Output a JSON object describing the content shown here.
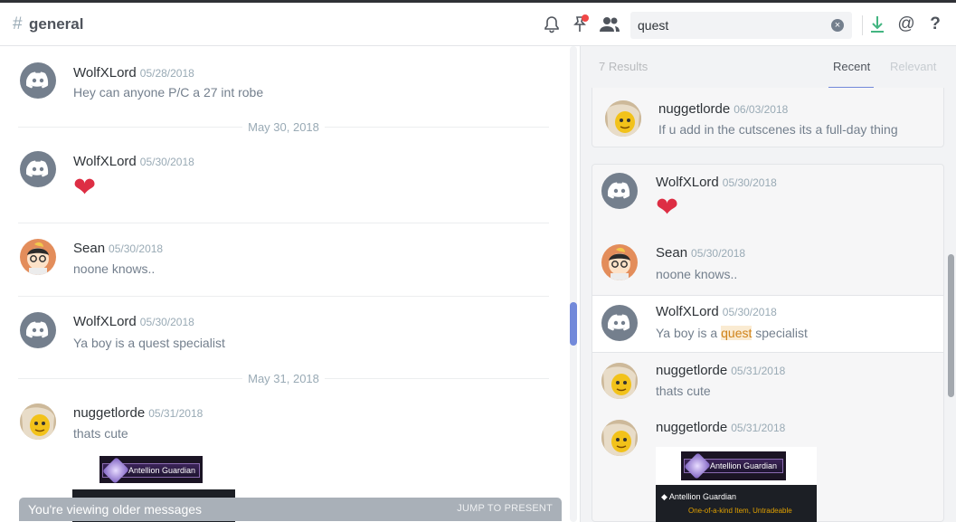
{
  "channel": {
    "hash": "#",
    "name": "general"
  },
  "search": {
    "query": "quest",
    "clear_glyph": "×"
  },
  "icons": [
    "bell-icon",
    "pin-icon",
    "members-icon",
    "download-icon",
    "mention-icon",
    "help-icon"
  ],
  "toolbar": {
    "mention_glyph": "@",
    "help_glyph": "?"
  },
  "chat": {
    "messages": [
      {
        "author": "WolfXLord",
        "timestamp": "05/28/2018",
        "text": "Hey can anyone P/C a 27 int robe"
      },
      {
        "author": "WolfXLord",
        "timestamp": "05/30/2018",
        "text": "❤"
      },
      {
        "author": "Sean",
        "timestamp": "05/30/2018",
        "text": "noone knows.."
      },
      {
        "author": "WolfXLord",
        "timestamp": "05/30/2018",
        "text": "Ya boy is a quest specialist"
      },
      {
        "author": "nuggetlorde",
        "timestamp": "05/31/2018",
        "text": "thats cute"
      }
    ],
    "dividers": [
      "May 30, 2018",
      "May 31, 2018"
    ],
    "embed": {
      "banner": "Antellion Guardian"
    },
    "older_notice": "You're viewing older messages",
    "jump_label": "JUMP TO PRESENT"
  },
  "results": {
    "count": "7 Results",
    "tabs": [
      {
        "label": "Recent",
        "active": true
      },
      {
        "label": "Relevant",
        "active": false
      }
    ],
    "top_message": {
      "author": "nuggetlorde",
      "timestamp": "06/03/2018",
      "text": "If u add in the cutscenes its a full-day thing"
    },
    "card_messages": [
      {
        "author": "WolfXLord",
        "timestamp": "05/30/2018",
        "text": "❤"
      },
      {
        "author": "Sean",
        "timestamp": "05/30/2018",
        "text": "noone knows.."
      },
      {
        "author": "WolfXLord",
        "timestamp": "05/30/2018",
        "text_before": "Ya boy is a ",
        "highlight": "quest",
        "text_after": " specialist"
      },
      {
        "author": "nuggetlorde",
        "timestamp": "05/31/2018",
        "text": "thats cute"
      },
      {
        "author": "nuggetlorde",
        "timestamp": "05/31/2018",
        "text": ""
      }
    ],
    "embed": {
      "banner": "Antellion Guardian",
      "title": "◆ Antellion Guardian",
      "subtitle": "One-of-a-kind Item, Untradeable"
    }
  },
  "colors": {
    "accent": "#7289da",
    "heart": "#dd2e44",
    "highlight_bg": "#faebd2",
    "highlight_text": "#d0831a",
    "download": "#43b581",
    "pin_badge": "#f04747"
  }
}
